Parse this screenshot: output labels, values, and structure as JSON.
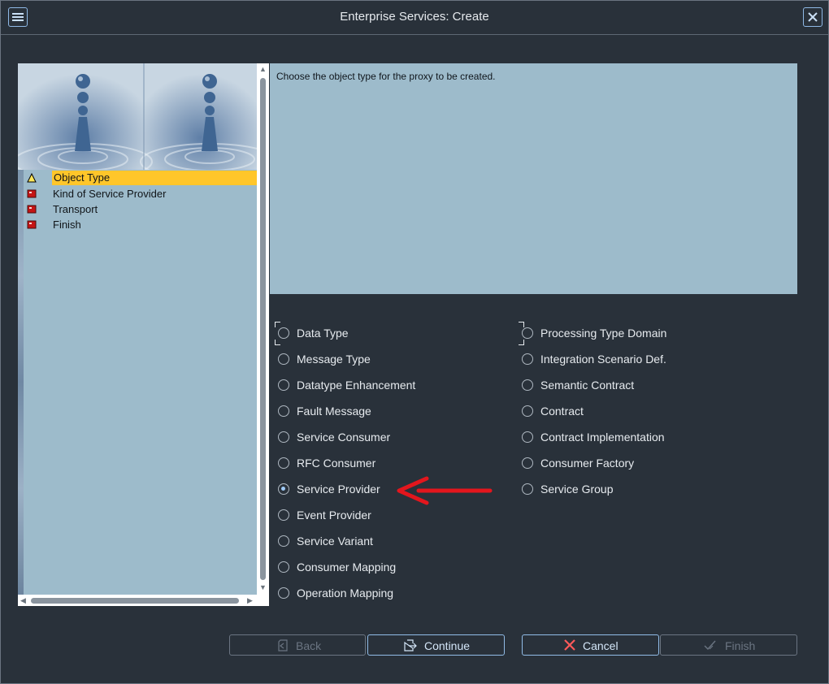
{
  "window": {
    "title": "Enterprise Services: Create"
  },
  "wizard_steps": [
    {
      "label": "Object Type",
      "status": "warning",
      "active": true
    },
    {
      "label": "Kind of Service Provider",
      "status": "error",
      "active": false
    },
    {
      "label": "Transport",
      "status": "error",
      "active": false
    },
    {
      "label": "Finish",
      "status": "error",
      "active": false
    }
  ],
  "info": {
    "text": "Choose the object type for the proxy to be created."
  },
  "object_types": {
    "column1": [
      {
        "label": "Data Type",
        "checked": false
      },
      {
        "label": "Message Type",
        "checked": false
      },
      {
        "label": "Datatype Enhancement",
        "checked": false
      },
      {
        "label": "Fault Message",
        "checked": false
      },
      {
        "label": "Service Consumer",
        "checked": false
      },
      {
        "label": "RFC Consumer",
        "checked": false
      },
      {
        "label": "Service Provider",
        "checked": true
      },
      {
        "label": "Event Provider",
        "checked": false
      },
      {
        "label": "Service Variant",
        "checked": false
      },
      {
        "label": "Consumer Mapping",
        "checked": false
      },
      {
        "label": "Operation Mapping",
        "checked": false
      }
    ],
    "column2": [
      {
        "label": "Processing Type Domain",
        "checked": false
      },
      {
        "label": "Integration Scenario Def.",
        "checked": false
      },
      {
        "label": "Semantic Contract",
        "checked": false
      },
      {
        "label": "Contract",
        "checked": false
      },
      {
        "label": "Contract Implementation",
        "checked": false
      },
      {
        "label": "Consumer Factory",
        "checked": false
      },
      {
        "label": "Service Group",
        "checked": false
      }
    ]
  },
  "buttons": {
    "back": "Back",
    "continue": "Continue",
    "cancel": "Cancel",
    "finish": "Finish"
  },
  "colors": {
    "background": "#29313a",
    "panel": "#9dbbcb",
    "active_step": "#ffc62a",
    "accent": "#91bce7",
    "annotation_arrow": "#e3161d"
  }
}
